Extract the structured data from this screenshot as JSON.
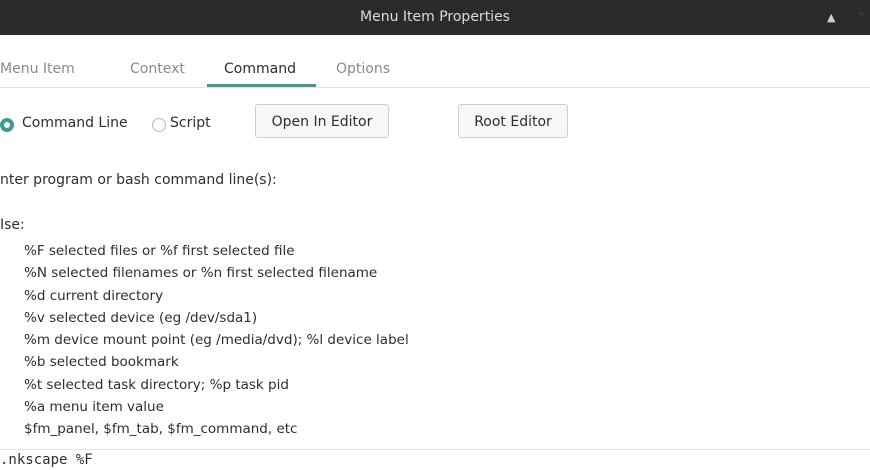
{
  "window": {
    "title": "Menu Item Properties",
    "eject_glyph": "▲",
    "extra_glyph": "◦"
  },
  "tabs": [
    {
      "label": "Menu Item",
      "active": false
    },
    {
      "label": "Context",
      "active": false
    },
    {
      "label": "Command",
      "active": true
    },
    {
      "label": "Options",
      "active": false
    }
  ],
  "command_type": {
    "command_line_label": "Command Line",
    "script_label": "Script",
    "selected": "Command Line"
  },
  "buttons": {
    "open_in_editor": "Open In Editor",
    "root_editor": "Root Editor"
  },
  "prompt_text": "nter program or bash command line(s):",
  "use_label": "Ise:",
  "help_lines": [
    "%F  selected files  or  %f first selected file",
    "%N  selected filenames  or  %n first selected filename",
    "%d  current directory",
    "%v  selected device (eg /dev/sda1)",
    "%m  device mount point (eg /media/dvd);  %l device label",
    "%b  selected bookmark",
    "%t  selected task directory;  %p task pid",
    "%a  menu item value",
    "$fm_panel, $fm_tab, $fm_command, etc"
  ],
  "command_value": ".nkscape %F",
  "colors": {
    "accent": "#3f9b8e",
    "titlebar": "#2b2b2b"
  }
}
